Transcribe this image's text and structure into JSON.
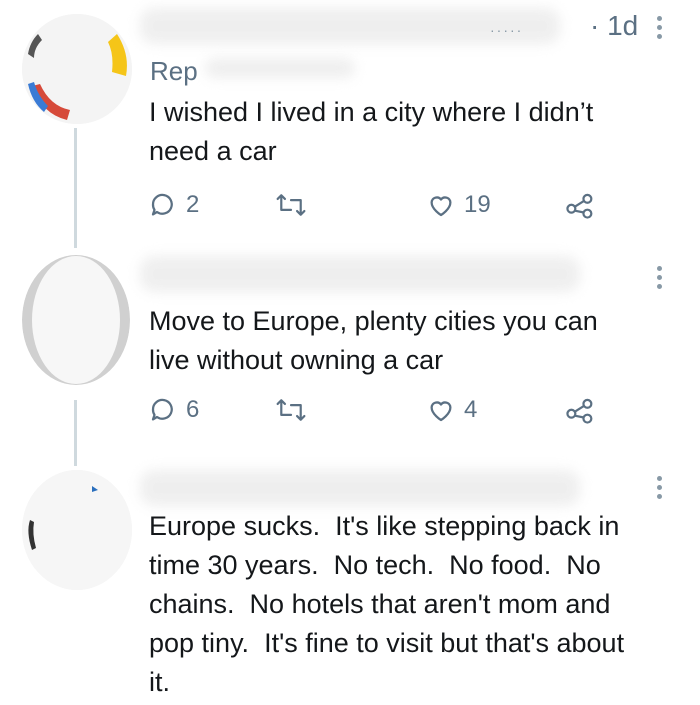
{
  "tweets": [
    {
      "handle": "Rep",
      "time": "· 1d",
      "text": "I wished I lived in a city where I didn’t\nneed a car",
      "replies": "2",
      "likes": "19",
      "icons": [
        "reply-icon",
        "retweet-icon",
        "like-icon",
        "share-icon"
      ]
    },
    {
      "text": "Move to Europe, plenty cities you can\nlive without owning a car",
      "replies": "6",
      "likes": "4",
      "icons": [
        "reply-icon",
        "retweet-icon",
        "like-icon",
        "share-icon"
      ]
    },
    {
      "text": "Europe sucks.  It's like stepping back in\ntime 30 years.  No tech.  No food.  No\nchains.  No hotels that aren't mom and\npop tiny.  It's fine to visit but that's about\nit."
    }
  ],
  "colors": {
    "text": "#14171a",
    "secondary": "#5b7083",
    "thread_line": "#cfd9de",
    "accent_blue": "#1d9bf0"
  }
}
